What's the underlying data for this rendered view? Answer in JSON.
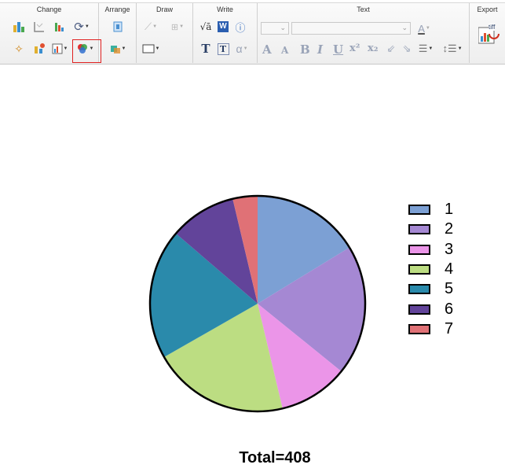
{
  "toolbar": {
    "groups": {
      "change": "Change",
      "arrange": "Arrange",
      "draw": "Draw",
      "write": "Write",
      "text": "Text",
      "export": "Export"
    },
    "text_buttons": {
      "font_color": "A",
      "grow_font": "A",
      "shrink_font": "A",
      "bold": "B",
      "italic": "I",
      "underline": "U",
      "superscript": "x²",
      "subscript": "x₂",
      "text_t": "T",
      "text_t_box": "T",
      "alpha": "α",
      "sqrt": "√ā",
      "word": "W"
    },
    "export_label": "tiff"
  },
  "chart_data": {
    "type": "pie",
    "categories": [
      "1",
      "2",
      "3",
      "4",
      "5",
      "6",
      "7"
    ],
    "values": [
      70,
      84,
      45,
      88,
      84,
      43,
      16
    ],
    "colors": [
      "#7ca0d4",
      "#a588d3",
      "#eb95e8",
      "#bcdd82",
      "#2a8aab",
      "#62449a",
      "#e07176"
    ],
    "start": "top",
    "direction": "clockwise",
    "legend": "right",
    "total_label": "Total=408"
  }
}
